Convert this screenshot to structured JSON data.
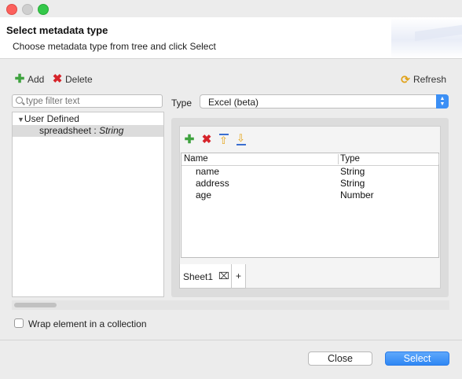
{
  "window": {
    "traffic_lights": [
      "#fc605c",
      "#cfcfcf",
      "#34c84a"
    ]
  },
  "header": {
    "title": "Select metadata type",
    "subtitle": "Choose metadata type from tree and click Select"
  },
  "toolbar": {
    "add_label": "Add",
    "delete_label": "Delete",
    "refresh_label": "Refresh"
  },
  "filter": {
    "placeholder": "type filter text",
    "value": ""
  },
  "tree": {
    "group_label": "User Defined",
    "item_name": "spreadsheet",
    "item_sep": " : ",
    "item_type": "String"
  },
  "type_select": {
    "label": "Type",
    "value": "Excel (beta)"
  },
  "table": {
    "columns": [
      "Name",
      "Type"
    ],
    "rows": [
      {
        "name": "name",
        "type": "String"
      },
      {
        "name": "address",
        "type": "String"
      },
      {
        "name": "age",
        "type": "Number"
      }
    ]
  },
  "tabs": {
    "sheet_label": "Sheet1",
    "close_glyph": "⌧",
    "add_label": "+"
  },
  "options": {
    "wrap_label": "Wrap element in a collection",
    "wrap_checked": false
  },
  "buttons": {
    "close_label": "Close",
    "select_label": "Select"
  },
  "colors": {
    "accent": "#2f87f4",
    "selection": "#dcdcdc"
  }
}
